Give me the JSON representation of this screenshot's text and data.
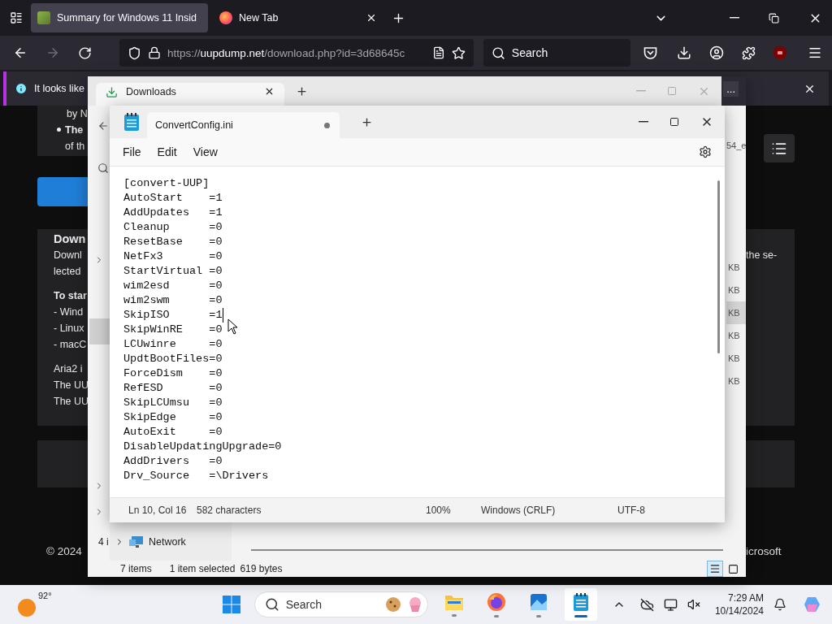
{
  "browser": {
    "tabs": [
      {
        "title": "Summary for Windows 11 Insid",
        "kind": "page",
        "selected": true
      },
      {
        "title": "New Tab",
        "kind": "firefox",
        "selected": false
      }
    ],
    "address": {
      "scheme": "https://",
      "host": "uupdump.net",
      "path": "/download.php?id=3d68645c"
    },
    "search": {
      "placeholder": "Search"
    },
    "notification": {
      "text": "It looks like",
      "more": "..."
    },
    "page": {
      "intro": {
        "line": "by N",
        "bullet_bold": "The",
        "bullet_rest": "of th"
      },
      "download": {
        "heading": "Down",
        "paragraph": [
          "Downl",
          "lected"
        ],
        "paragraph_right": "the se-",
        "steps_title": "To star",
        "steps": [
          "- Wind",
          "- Linux",
          "- macC"
        ],
        "notes": [
          "Aria2 i",
          "The UU",
          "The UU"
        ]
      },
      "footer": {
        "copyright": "© 2024",
        "right": "icrosoft"
      }
    }
  },
  "explorer": {
    "tab": "Downloads",
    "file_fragment": "54_e",
    "rows": [
      {
        "size": "KB",
        "selected": false
      },
      {
        "size": "KB",
        "selected": false
      },
      {
        "size": "KB",
        "selected": true
      },
      {
        "size": "KB",
        "selected": false
      },
      {
        "size": "KB",
        "selected": false
      },
      {
        "size": "KB",
        "selected": false
      }
    ],
    "nav": [
      {
        "label": "Network"
      }
    ],
    "count_fragment": "4 i",
    "status": {
      "count": "7 items",
      "selection": "1 item selected",
      "size": "619 bytes"
    },
    "views": [
      {
        "kind": "details",
        "selected": true
      },
      {
        "kind": "tiles",
        "selected": false
      }
    ]
  },
  "notepad": {
    "tab": {
      "title": "ConvertConfig.ini",
      "unsaved": true
    },
    "menu": [
      "File",
      "Edit",
      "View"
    ],
    "lines": [
      {
        "text": "[convert-UUP]",
        "caret": false
      },
      {
        "text": "AutoStart    =1",
        "caret": false
      },
      {
        "text": "AddUpdates   =1",
        "caret": false
      },
      {
        "text": "Cleanup      =0",
        "caret": false
      },
      {
        "text": "ResetBase    =0",
        "caret": false
      },
      {
        "text": "NetFx3       =0",
        "caret": false
      },
      {
        "text": "StartVirtual =0",
        "caret": false
      },
      {
        "text": "wim2esd      =0",
        "caret": false
      },
      {
        "text": "wim2swm      =0",
        "caret": false
      },
      {
        "text": "SkipISO      =1",
        "caret": true
      },
      {
        "text": "SkipWinRE    =0",
        "caret": false
      },
      {
        "text": "LCUwinre     =0",
        "caret": false
      },
      {
        "text": "UpdtBootFiles=0",
        "caret": false
      },
      {
        "text": "ForceDism    =0",
        "caret": false
      },
      {
        "text": "RefESD       =0",
        "caret": false
      },
      {
        "text": "SkipLCUmsu   =0",
        "caret": false
      },
      {
        "text": "SkipEdge     =0",
        "caret": false
      },
      {
        "text": "AutoExit     =0",
        "caret": false
      },
      {
        "text": "DisableUpdatingUpgrade=0",
        "caret": false
      },
      {
        "text": "AddDrivers   =0",
        "caret": false
      },
      {
        "text": "Drv_Source   =\\Drivers",
        "caret": false
      }
    ],
    "status": {
      "position": "Ln 10, Col 16",
      "characters": "582 characters",
      "zoom": "100%",
      "line_ending": "Windows (CRLF)",
      "encoding": "UTF-8"
    }
  },
  "taskbar": {
    "weather": {
      "temperature": "92°"
    },
    "search": {
      "placeholder": "Search"
    },
    "apps": [
      {
        "kind": "explorer",
        "active": false
      },
      {
        "kind": "firefox",
        "active": false
      },
      {
        "kind": "photos",
        "active": false
      },
      {
        "kind": "notepad",
        "active": true
      }
    ],
    "time": "7:29 AM",
    "date": "10/14/2024"
  }
}
